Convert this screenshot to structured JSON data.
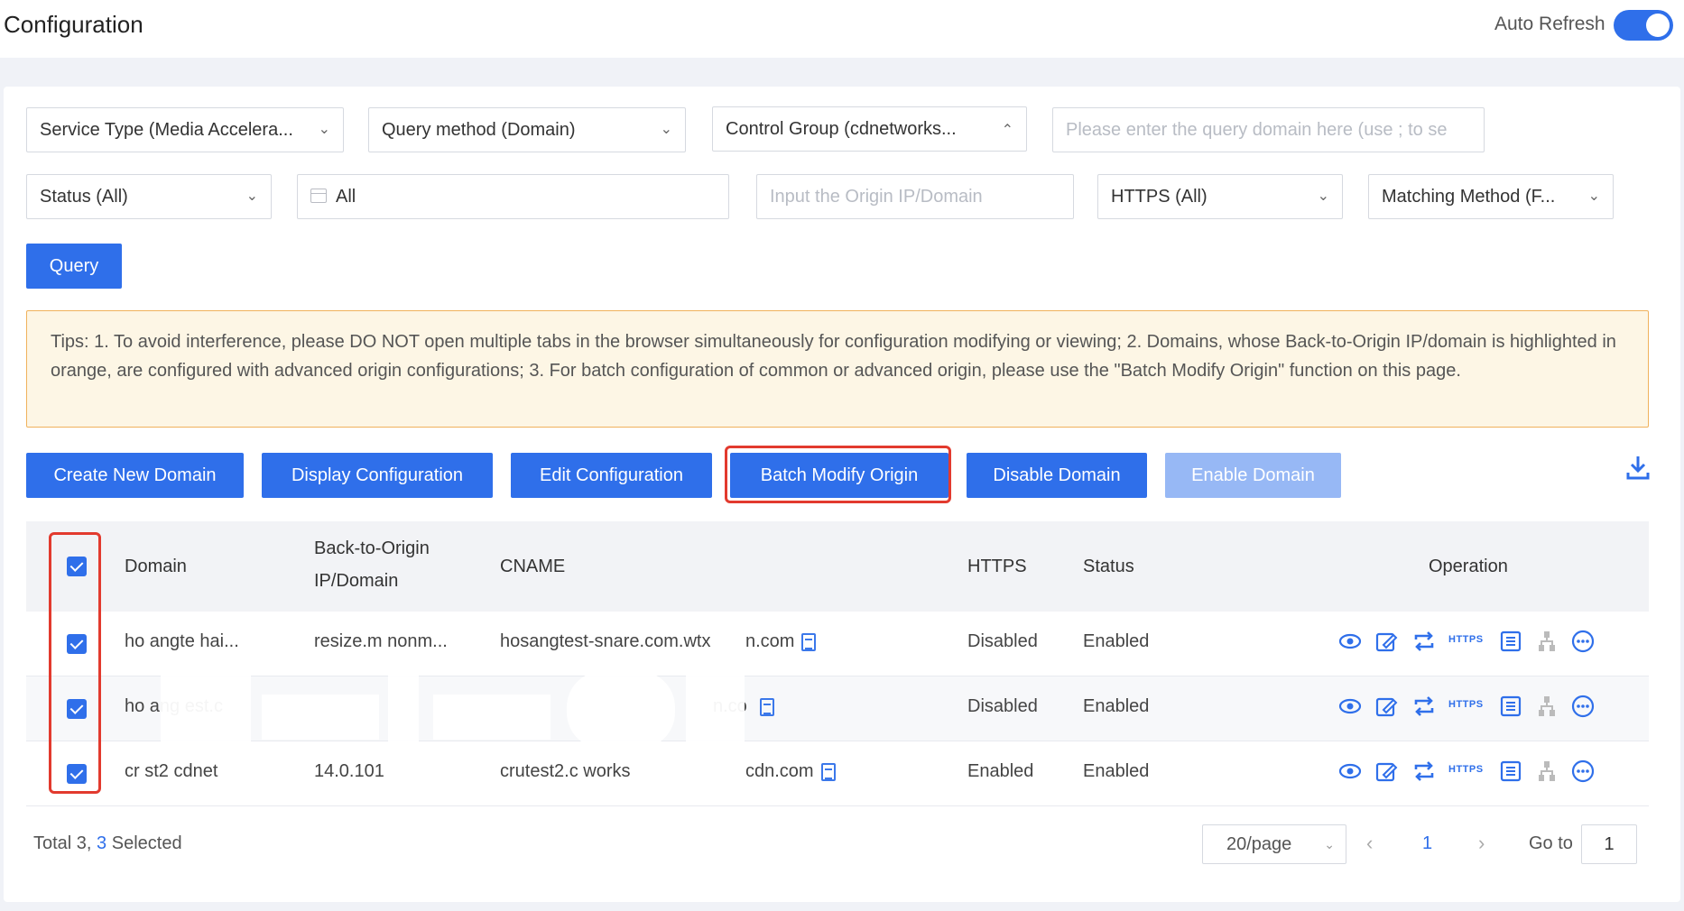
{
  "header": {
    "title": "Configuration",
    "auto_refresh_label": "Auto Refresh",
    "auto_refresh_on": true
  },
  "filters": {
    "service_type": "Service Type (Media Accelera...",
    "query_method": "Query method (Domain)",
    "control_group": "Control Group (cdnetworks...",
    "query_domain_placeholder": "Please enter the query domain here (use ; to se",
    "status": "Status (All)",
    "date": "All",
    "origin_placeholder": "Input the Origin IP/Domain",
    "https": "HTTPS (All)",
    "matching_method": "Matching Method (F..."
  },
  "query_label": "Query",
  "tips_text": "Tips: 1. To avoid interference, please DO NOT open multiple tabs in the browser simultaneously for configuration modifying or viewing; 2. Domains, whose Back-to-Origin IP/domain is highlighted in orange, are configured with advanced origin configurations; 3. For batch configuration of common or advanced origin, please use the \"Batch Modify Origin\" function on this page.",
  "actions": {
    "create": "Create New Domain",
    "display": "Display Configuration",
    "edit": "Edit Configuration",
    "batch": "Batch Modify Origin",
    "disable": "Disable Domain",
    "enable": "Enable Domain"
  },
  "table": {
    "headers": {
      "domain": "Domain",
      "origin_line1": "Back-to-Origin",
      "origin_line2": "IP/Domain",
      "cname": "CNAME",
      "https": "HTTPS",
      "status": "Status",
      "operation": "Operation"
    },
    "rows": [
      {
        "domain": "ho  angte  hai...",
        "origin": "resize.m  nonm...",
        "cname": "hosangtest-snare.com.wtx",
        "cname_tail": "n.com",
        "https": "Disabled",
        "status": "Enabled"
      },
      {
        "domain": "ho  ang  est.c",
        "origin": "",
        "cname": "",
        "cname_tail": "n.co",
        "https": "Disabled",
        "status": "Enabled"
      },
      {
        "domain": "cr   st2 cdnet",
        "origin": "14.0.101",
        "cname": "crutest2.c  works",
        "cname_tail": "cdn.com",
        "https": "Enabled",
        "status": "Enabled"
      }
    ],
    "op_https_label": "HTTPS"
  },
  "footer": {
    "total_prefix": "Total 3, ",
    "selected_count": "3",
    "selected_suffix": " Selected",
    "page_size": "20/page",
    "current_page": "1",
    "goto_label": "Go to",
    "goto_value": "1"
  },
  "colors": {
    "primary": "#2f6fea",
    "primary_disabled": "#97b8f5",
    "highlight": "#e23a2e",
    "tips_border": "#f0b25c",
    "tips_bg": "#fdf6e5"
  }
}
